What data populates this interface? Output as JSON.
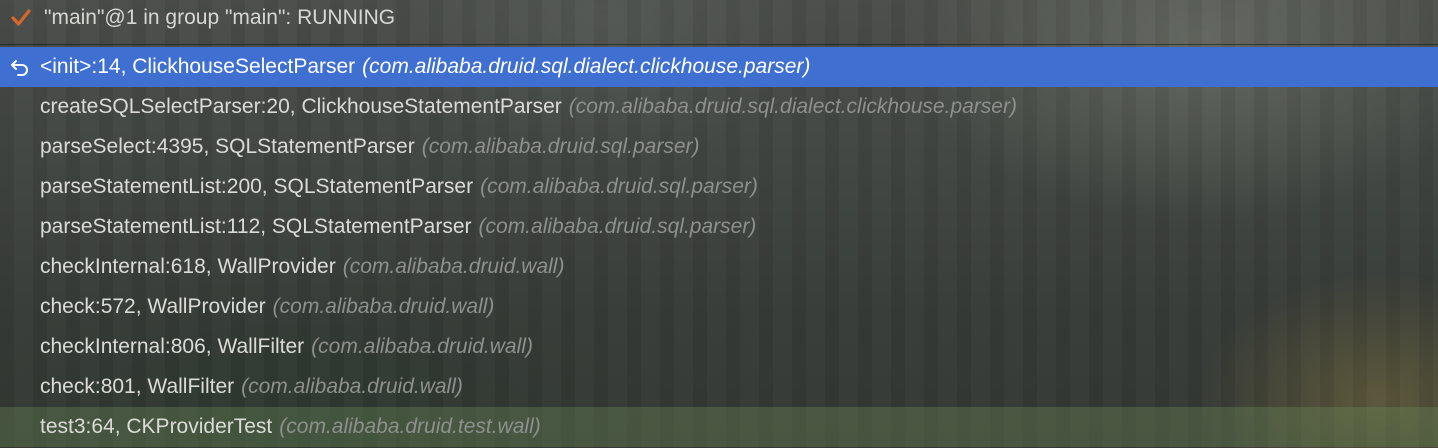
{
  "thread": {
    "status_label": "\"main\"@1 in group \"main\": RUNNING",
    "status_icon": "checkmark-icon",
    "accent": "#d8672e"
  },
  "frames": [
    {
      "location": "<init>:14, ClickhouseSelectParser",
      "package": "(com.alibaba.druid.sql.dialect.clickhouse.parser)",
      "selected": true,
      "icon": "drop-frame-icon"
    },
    {
      "location": "createSQLSelectParser:20, ClickhouseStatementParser",
      "package": "(com.alibaba.druid.sql.dialect.clickhouse.parser)"
    },
    {
      "location": "parseSelect:4395, SQLStatementParser",
      "package": "(com.alibaba.druid.sql.parser)"
    },
    {
      "location": "parseStatementList:200, SQLStatementParser",
      "package": "(com.alibaba.druid.sql.parser)"
    },
    {
      "location": "parseStatementList:112, SQLStatementParser",
      "package": "(com.alibaba.druid.sql.parser)"
    },
    {
      "location": "checkInternal:618, WallProvider",
      "package": "(com.alibaba.druid.wall)"
    },
    {
      "location": "check:572, WallProvider",
      "package": "(com.alibaba.druid.wall)"
    },
    {
      "location": "checkInternal:806, WallFilter",
      "package": "(com.alibaba.druid.wall)"
    },
    {
      "location": "check:801, WallFilter",
      "package": "(com.alibaba.druid.wall)"
    },
    {
      "location": "test3:64, CKProviderTest",
      "package": "(com.alibaba.druid.test.wall)",
      "highlight": "test-source"
    }
  ],
  "colors": {
    "selection": "#3f6fd0",
    "package_text": "#8d908c",
    "frame_text": "#dadbd7"
  }
}
